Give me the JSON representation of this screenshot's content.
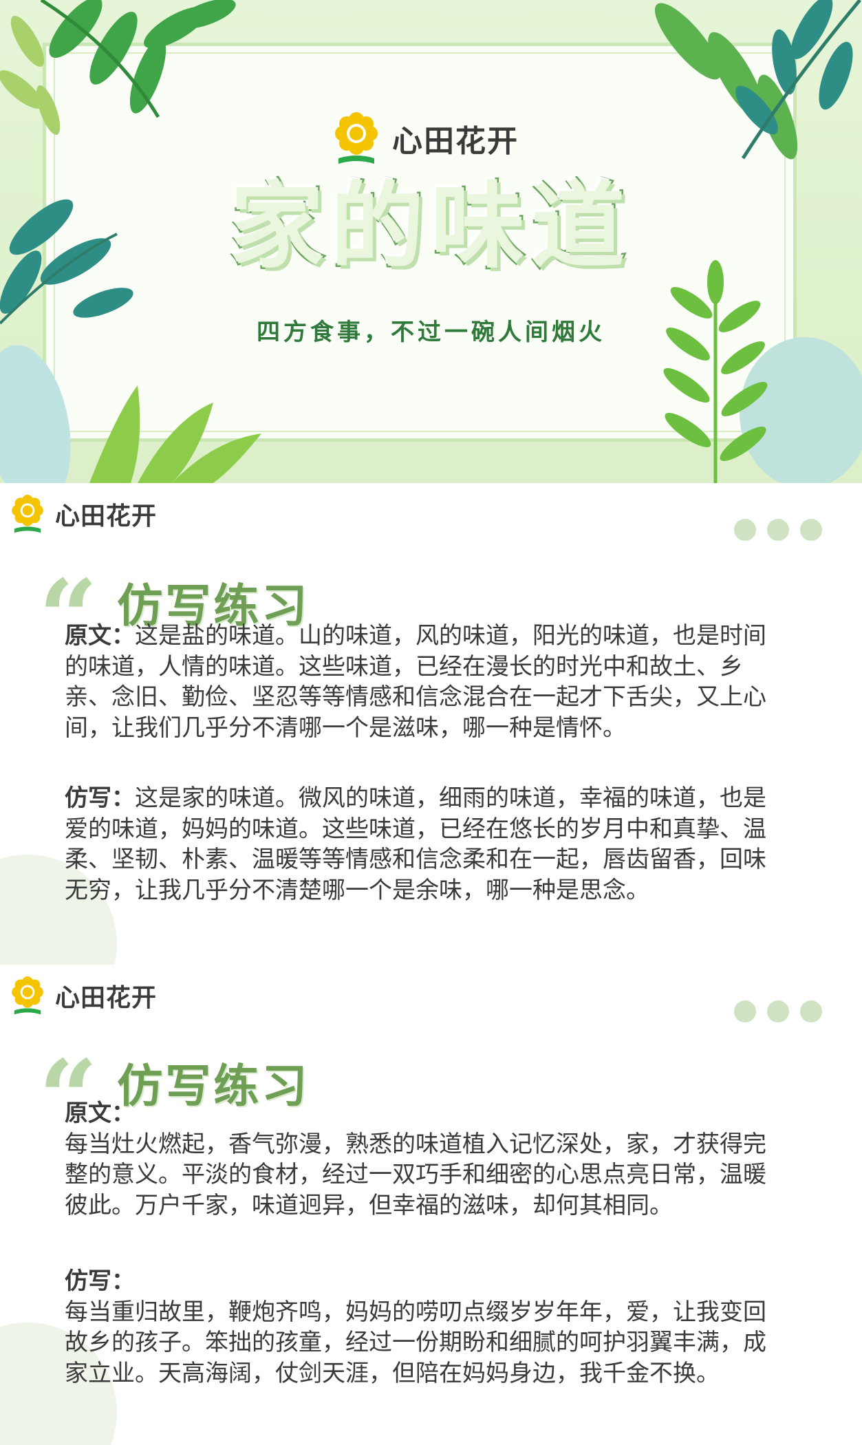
{
  "banner": {
    "brand": "心田花开",
    "title": "家的味道",
    "subtitle": "四方食事，不过一碗人间烟火"
  },
  "sections": [
    {
      "brand": "心田花开",
      "heading": "仿写练习",
      "original_label": "原文：",
      "original_text": "这是盐的味道。山的味道，风的味道，阳光的味道，也是时间的味道，人情的味道。这些味道，已经在漫长的时光中和故土、乡亲、念旧、勤俭、坚忍等等情感和信念混合在一起才下舌尖，又上心间，让我们几乎分不清哪一个是滋味，哪一种是情怀。",
      "imitation_label": "仿写：",
      "imitation_text": "这是家的味道。微风的味道，细雨的味道，幸福的味道，也是爱的味道，妈妈的味道。这些味道，已经在悠长的岁月中和真挚、温柔、坚韧、朴素、温暖等等情感和信念柔和在一起，唇齿留香，回味无穷，让我几乎分不清楚哪一个是余味，哪一种是思念。"
    },
    {
      "brand": "心田花开",
      "heading": "仿写练习",
      "original_label": "原文：",
      "original_text": "每当灶火燃起，香气弥漫，熟悉的味道植入记忆深处，家，才获得完整的意义。平淡的食材，经过一双巧手和细密的心思点亮日常，温暖彼此。万户千家，味道迥异，但幸福的滋味，却何其相同。",
      "imitation_label": "仿写：",
      "imitation_text": "每当重归故里，鞭炮齐鸣，妈妈的唠叨点缀岁岁年年，爱，让我变回故乡的孩子。笨拙的孩童，经过一份期盼和细腻的呵护羽翼丰满，成家立业。天高海阔，仗剑天涯，但陪在妈妈身边，我千金不换。"
    }
  ],
  "colors": {
    "accent_green": "#6f9f55",
    "title_green": "#2f7a3a",
    "sunflower_yellow": "#f5c400",
    "logo_green": "#2aa84a"
  },
  "icons": [
    "sunflower-logo-icon",
    "leaf-decoration-icon",
    "quote-mark-icon"
  ]
}
